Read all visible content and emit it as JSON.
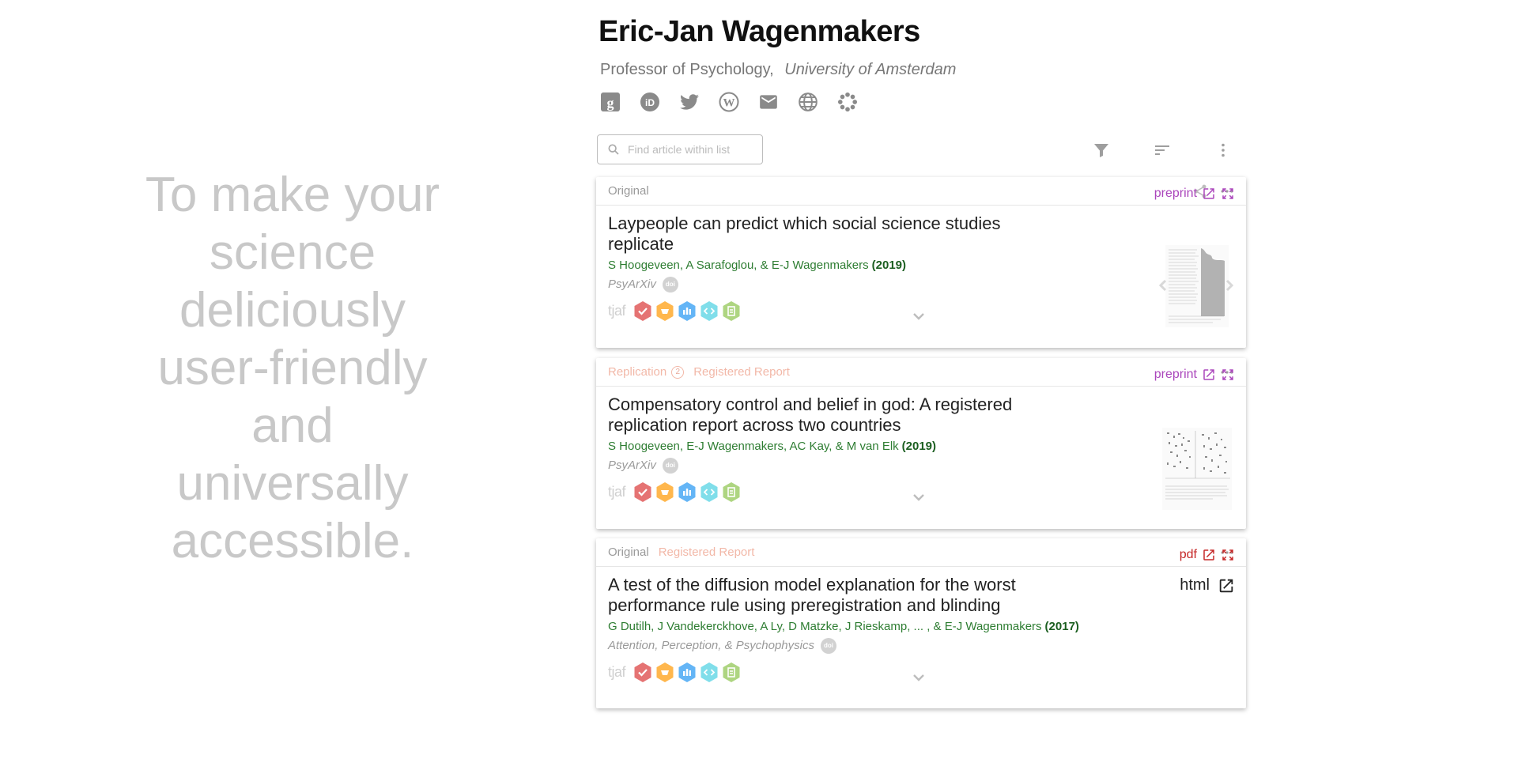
{
  "tagline": [
    "To make your",
    "science",
    "deliciously",
    "user-friendly",
    "and",
    "universally",
    "accessible."
  ],
  "profile": {
    "name": "Eric-Jan Wagenmakers",
    "position": "Professor of Psychology,",
    "institution": "University of Amsterdam",
    "links": [
      "google-scholar-icon",
      "orcid-icon",
      "twitter-icon",
      "wordpress-icon",
      "email-icon",
      "website-icon",
      "settings-icon"
    ]
  },
  "toolbar": {
    "search_placeholder": "Find article within list",
    "icons": [
      "filter-icon",
      "sort-icon",
      "more-vertical-icon"
    ]
  },
  "colors": {
    "preprint": "#ab47bc",
    "pdf": "#c62828",
    "authors": "#2e7d32",
    "tag_muted": "#f2b8a8",
    "badge_red": "#e57373",
    "badge_orange": "#ffb74d",
    "badge_blue": "#64b5f6",
    "badge_teal": "#80deea",
    "badge_green": "#aed581"
  },
  "articles": [
    {
      "type": "Original",
      "replication_count": "",
      "registered_report": "",
      "title": "Laypeople can predict which social science studies replicate",
      "authors": "S Hoogeveen, A Sarafoglou, & E-J Wagenmakers",
      "year": "(2019)",
      "journal": "PsyArXiv",
      "doi": "doi",
      "tjaf": "tjaf",
      "file_label": "preprint"
    },
    {
      "type": "Replication",
      "replication_count": "2",
      "registered_report": "Registered Report",
      "title": "Compensatory control and belief in god: A registered replication report across two countries",
      "authors": "S Hoogeveen, E-J Wagenmakers, AC Kay, & M van Elk",
      "year": "(2019)",
      "journal": "PsyArXiv",
      "doi": "doi",
      "tjaf": "tjaf",
      "file_label": "preprint"
    },
    {
      "type": "Original",
      "replication_count": "",
      "registered_report": "Registered Report",
      "title": "A test of the diffusion model explanation for the worst performance rule using preregistration and blinding",
      "authors": "G Dutilh, J Vandekerckhove, A Ly, D Matzke, J Rieskamp, ... , & E-J Wagenmakers",
      "year": "(2017)",
      "journal": "Attention, Perception, & Psychophysics",
      "doi": "doi",
      "tjaf": "tjaf",
      "file_label": "pdf",
      "html_label": "html"
    }
  ]
}
